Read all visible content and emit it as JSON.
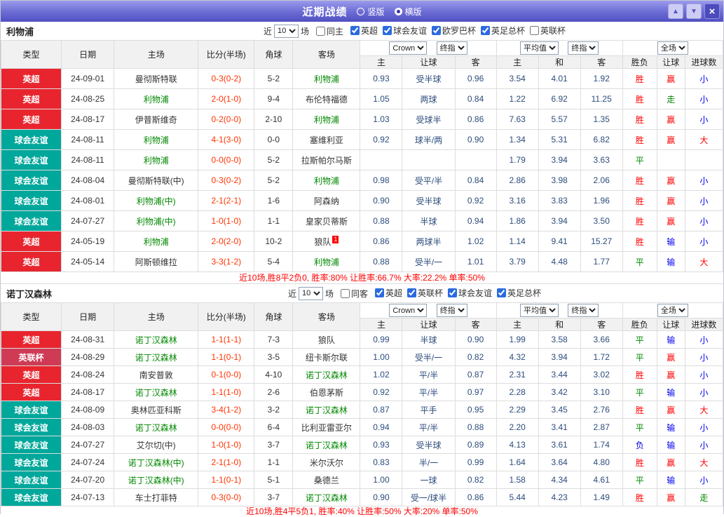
{
  "topbar": {
    "title": "近期战绩",
    "radios": [
      {
        "label": "竖版",
        "selected": false
      },
      {
        "label": "横版",
        "selected": true
      }
    ],
    "icons": {
      "up": "▲",
      "down": "▼",
      "close": "×"
    }
  },
  "labels": {
    "near": "近",
    "games": "场"
  },
  "table_header": {
    "type": "类型",
    "date": "日期",
    "home": "主场",
    "score": "比分(半场)",
    "corner": "角球",
    "away": "客场",
    "bookmaker": "Crown",
    "stage": "终指",
    "average": "平均值",
    "stage2": "终指",
    "scope": "全场",
    "sub": [
      "主",
      "让球",
      "客",
      "主",
      "和",
      "客",
      "胜负",
      "让球",
      "进球数"
    ]
  },
  "colors": {
    "topbar_bg": "#6b6bd4",
    "epl_badge": "#e8252e",
    "friendly_badge": "#00a79b",
    "league_cup_badge": "#cf3b55",
    "team_highlight": "#008800",
    "score_text": "#ff3300",
    "odds_text": "#2c4c7c",
    "win_red": "#ff0000",
    "draw_green": "#008800",
    "lose_blue": "#0000ee",
    "summary_text": "#ff0000"
  },
  "sections": [
    {
      "team": "利物浦",
      "filter": {
        "count": "10",
        "same_label": "同主",
        "same_checked": false,
        "leagues": [
          {
            "label": "英超",
            "checked": true
          },
          {
            "label": "球会友谊",
            "checked": true
          },
          {
            "label": "欧罗巴杯",
            "checked": true
          },
          {
            "label": "英足总杯",
            "checked": true
          },
          {
            "label": "英联杯",
            "checked": false
          }
        ]
      },
      "rows": [
        {
          "type": "英超",
          "date": "24-09-01",
          "home": "曼彻斯特联",
          "home_hl": false,
          "score": "0-3(0-2)",
          "corner": "5-2",
          "away": "利物浦",
          "away_hl": true,
          "odds": [
            "0.93",
            "受半球",
            "0.96"
          ],
          "avg": [
            "3.54",
            "4.01",
            "1.92"
          ],
          "result": "胜",
          "handicap": "赢",
          "goals": "小"
        },
        {
          "type": "英超",
          "date": "24-08-25",
          "home": "利物浦",
          "home_hl": true,
          "score": "2-0(1-0)",
          "corner": "9-4",
          "away": "布伦特福德",
          "away_hl": false,
          "odds": [
            "1.05",
            "两球",
            "0.84"
          ],
          "avg": [
            "1.22",
            "6.92",
            "11.25"
          ],
          "result": "胜",
          "handicap": "走",
          "goals": "小"
        },
        {
          "type": "英超",
          "date": "24-08-17",
          "home": "伊普斯维奇",
          "home_hl": false,
          "score": "0-2(0-0)",
          "corner": "2-10",
          "away": "利物浦",
          "away_hl": true,
          "odds": [
            "1.03",
            "受球半",
            "0.86"
          ],
          "avg": [
            "7.63",
            "5.57",
            "1.35"
          ],
          "result": "胜",
          "handicap": "赢",
          "goals": "小"
        },
        {
          "type": "球会友谊",
          "date": "24-08-11",
          "home": "利物浦",
          "home_hl": true,
          "score": "4-1(3-0)",
          "corner": "0-0",
          "away": "塞维利亚",
          "away_hl": false,
          "odds": [
            "0.92",
            "球半/两",
            "0.90"
          ],
          "avg": [
            "1.34",
            "5.31",
            "6.82"
          ],
          "result": "胜",
          "handicap": "赢",
          "goals": "大"
        },
        {
          "type": "球会友谊",
          "date": "24-08-11",
          "home": "利物浦",
          "home_hl": true,
          "score": "0-0(0-0)",
          "corner": "5-2",
          "away": "拉斯帕尔马斯",
          "away_hl": false,
          "odds": [
            "",
            "",
            ""
          ],
          "avg": [
            "1.79",
            "3.94",
            "3.63"
          ],
          "result": "平",
          "handicap": "",
          "goals": ""
        },
        {
          "type": "球会友谊",
          "date": "24-08-04",
          "home": "曼彻斯特联(中)",
          "home_hl": false,
          "score": "0-3(0-2)",
          "corner": "5-2",
          "away": "利物浦",
          "away_hl": true,
          "odds": [
            "0.98",
            "受平/半",
            "0.84"
          ],
          "avg": [
            "2.86",
            "3.98",
            "2.06"
          ],
          "result": "胜",
          "handicap": "赢",
          "goals": "小"
        },
        {
          "type": "球会友谊",
          "date": "24-08-01",
          "home": "利物浦(中)",
          "home_hl": true,
          "score": "2-1(2-1)",
          "corner": "1-6",
          "away": "阿森纳",
          "away_hl": false,
          "odds": [
            "0.90",
            "受半球",
            "0.92"
          ],
          "avg": [
            "3.16",
            "3.83",
            "1.96"
          ],
          "result": "胜",
          "handicap": "赢",
          "goals": "小"
        },
        {
          "type": "球会友谊",
          "date": "24-07-27",
          "home": "利物浦(中)",
          "home_hl": true,
          "score": "1-0(1-0)",
          "corner": "1-1",
          "away": "皇家贝蒂斯",
          "away_hl": false,
          "odds": [
            "0.88",
            "半球",
            "0.94"
          ],
          "avg": [
            "1.86",
            "3.94",
            "3.50"
          ],
          "result": "胜",
          "handicap": "赢",
          "goals": "小"
        },
        {
          "type": "英超",
          "date": "24-05-19",
          "home": "利物浦",
          "home_hl": true,
          "score": "2-0(2-0)",
          "corner": "10-2",
          "away": "狼队",
          "away_hl": false,
          "away_badge": "1",
          "odds": [
            "0.86",
            "两球半",
            "1.02"
          ],
          "avg": [
            "1.14",
            "9.41",
            "15.27"
          ],
          "result": "胜",
          "handicap": "输",
          "goals": "小"
        },
        {
          "type": "英超",
          "date": "24-05-14",
          "home": "阿斯顿维拉",
          "home_hl": false,
          "score": "3-3(1-2)",
          "corner": "5-4",
          "away": "利物浦",
          "away_hl": true,
          "odds": [
            "0.88",
            "受半/一",
            "1.01"
          ],
          "avg": [
            "3.79",
            "4.48",
            "1.77"
          ],
          "result": "平",
          "handicap": "输",
          "goals": "大"
        }
      ],
      "summary": "近10场,胜8平2负0, 胜率:80% 让胜率:66.7% 大率:22.2% 单率:50%"
    },
    {
      "team": "诺丁汉森林",
      "filter": {
        "count": "10",
        "same_label": "同客",
        "same_checked": false,
        "leagues": [
          {
            "label": "英超",
            "checked": true
          },
          {
            "label": "英联杯",
            "checked": true
          },
          {
            "label": "球会友谊",
            "checked": true
          },
          {
            "label": "英足总杯",
            "checked": true
          }
        ]
      },
      "rows": [
        {
          "type": "英超",
          "date": "24-08-31",
          "home": "诺丁汉森林",
          "home_hl": true,
          "score": "1-1(1-1)",
          "corner": "7-3",
          "away": "狼队",
          "away_hl": false,
          "odds": [
            "0.99",
            "半球",
            "0.90"
          ],
          "avg": [
            "1.99",
            "3.58",
            "3.66"
          ],
          "result": "平",
          "handicap": "输",
          "goals": "小"
        },
        {
          "type": "英联杯",
          "date": "24-08-29",
          "home": "诺丁汉森林",
          "home_hl": true,
          "score": "1-1(0-1)",
          "corner": "3-5",
          "away": "纽卡斯尔联",
          "away_hl": false,
          "odds": [
            "1.00",
            "受半/一",
            "0.82"
          ],
          "avg": [
            "4.32",
            "3.94",
            "1.72"
          ],
          "result": "平",
          "handicap": "赢",
          "goals": "小"
        },
        {
          "type": "英超",
          "date": "24-08-24",
          "home": "南安普敦",
          "home_hl": false,
          "score": "0-1(0-0)",
          "corner": "4-10",
          "away": "诺丁汉森林",
          "away_hl": true,
          "odds": [
            "1.02",
            "平/半",
            "0.87"
          ],
          "avg": [
            "2.31",
            "3.44",
            "3.02"
          ],
          "result": "胜",
          "handicap": "赢",
          "goals": "小"
        },
        {
          "type": "英超",
          "date": "24-08-17",
          "home": "诺丁汉森林",
          "home_hl": true,
          "score": "1-1(1-0)",
          "corner": "2-6",
          "away": "伯恩茅斯",
          "away_hl": false,
          "odds": [
            "0.92",
            "平/半",
            "0.97"
          ],
          "avg": [
            "2.28",
            "3.42",
            "3.10"
          ],
          "result": "平",
          "handicap": "输",
          "goals": "小"
        },
        {
          "type": "球会友谊",
          "date": "24-08-09",
          "home": "奥林匹亚科斯",
          "home_hl": false,
          "score": "3-4(1-2)",
          "corner": "3-2",
          "away": "诺丁汉森林",
          "away_hl": true,
          "odds": [
            "0.87",
            "平手",
            "0.95"
          ],
          "avg": [
            "2.29",
            "3.45",
            "2.76"
          ],
          "result": "胜",
          "handicap": "赢",
          "goals": "大"
        },
        {
          "type": "球会友谊",
          "date": "24-08-03",
          "home": "诺丁汉森林",
          "home_hl": true,
          "score": "0-0(0-0)",
          "corner": "6-4",
          "away": "比利亚雷亚尔",
          "away_hl": false,
          "odds": [
            "0.94",
            "平/半",
            "0.88"
          ],
          "avg": [
            "2.20",
            "3.41",
            "2.87"
          ],
          "result": "平",
          "handicap": "输",
          "goals": "小"
        },
        {
          "type": "球会友谊",
          "date": "24-07-27",
          "home": "艾尔切(中)",
          "home_hl": false,
          "score": "1-0(1-0)",
          "corner": "3-7",
          "away": "诺丁汉森林",
          "away_hl": true,
          "odds": [
            "0.93",
            "受半球",
            "0.89"
          ],
          "avg": [
            "4.13",
            "3.61",
            "1.74"
          ],
          "result": "负",
          "handicap": "输",
          "goals": "小"
        },
        {
          "type": "球会友谊",
          "date": "24-07-24",
          "home": "诺丁汉森林(中)",
          "home_hl": true,
          "score": "2-1(1-0)",
          "corner": "1-1",
          "away": "米尔沃尔",
          "away_hl": false,
          "odds": [
            "0.83",
            "半/一",
            "0.99"
          ],
          "avg": [
            "1.64",
            "3.64",
            "4.80"
          ],
          "result": "胜",
          "handicap": "赢",
          "goals": "大"
        },
        {
          "type": "球会友谊",
          "date": "24-07-20",
          "home": "诺丁汉森林(中)",
          "home_hl": true,
          "score": "1-1(0-1)",
          "corner": "5-1",
          "away": "桑德兰",
          "away_hl": false,
          "odds": [
            "1.00",
            "一球",
            "0.82"
          ],
          "avg": [
            "1.58",
            "4.34",
            "4.61"
          ],
          "result": "平",
          "handicap": "输",
          "goals": "小"
        },
        {
          "type": "球会友谊",
          "date": "24-07-13",
          "home": "车士打菲特",
          "home_hl": false,
          "score": "0-3(0-0)",
          "corner": "3-7",
          "away": "诺丁汉森林",
          "away_hl": true,
          "odds": [
            "0.90",
            "受一/球半",
            "0.86"
          ],
          "avg": [
            "5.44",
            "4.23",
            "1.49"
          ],
          "result": "胜",
          "handicap": "赢",
          "goals": "走"
        }
      ],
      "summary": "近10场,胜4平5负1, 胜率:40% 让胜率:50% 大率:20% 单率:50%"
    }
  ]
}
